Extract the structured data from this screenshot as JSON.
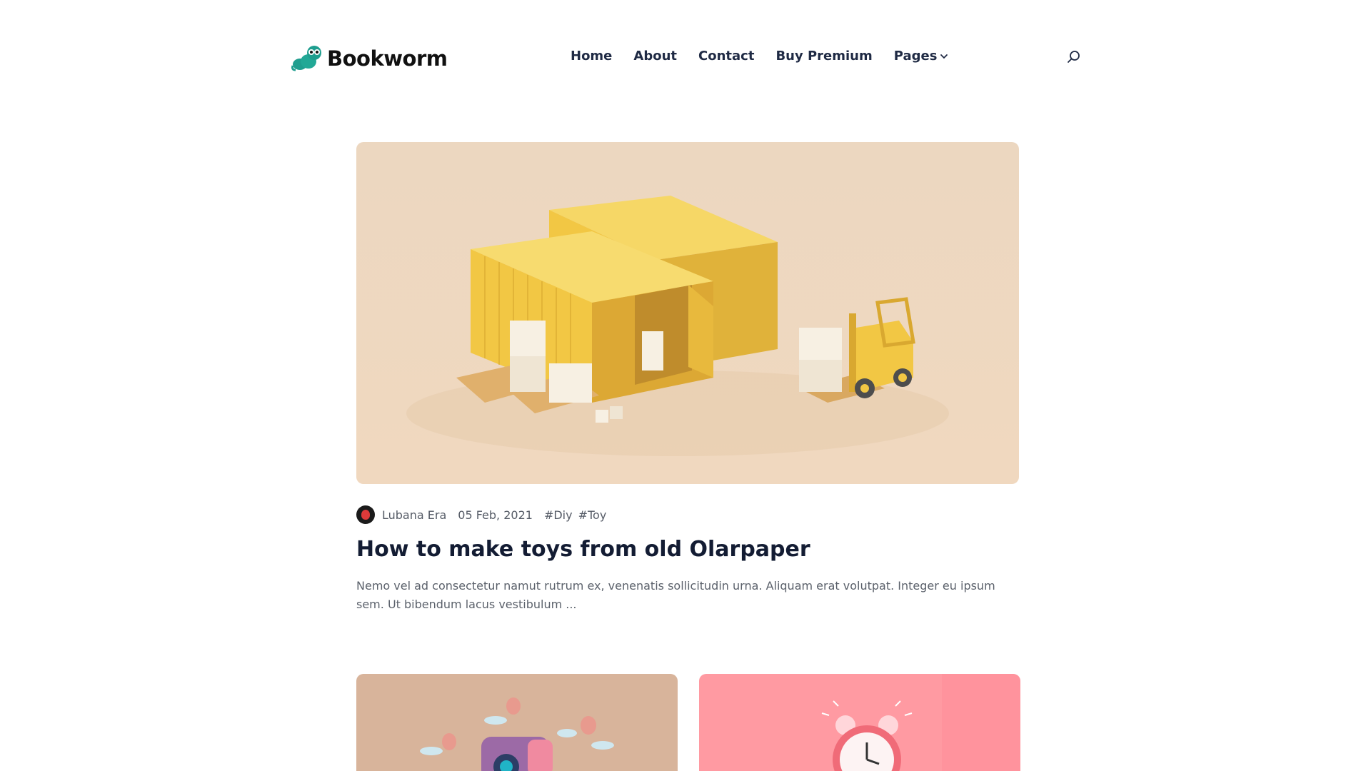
{
  "brand": {
    "name": "Bookworm",
    "logo_icon": "bookworm-logo-icon"
  },
  "nav": {
    "items": [
      {
        "label": "Home"
      },
      {
        "label": "About"
      },
      {
        "label": "Contact"
      },
      {
        "label": "Buy Premium"
      },
      {
        "label": "Pages",
        "has_dropdown": true
      }
    ],
    "search_icon": "search-icon"
  },
  "featured": {
    "image_icon": "shipping-containers-illustration",
    "author": "Lubana Era",
    "date": "05 Feb, 2021",
    "tags": [
      "#Diy",
      "#Toy"
    ],
    "title": "How to make toys from old Olarpaper",
    "excerpt": "Nemo vel ad consectetur namut rutrum ex, venenatis sollicitudin urna. Aliquam erat volutpat. Integer eu ipsum sem. Ut bibendum lacus vestibulum ..."
  },
  "cards": [
    {
      "image_icon": "camera-balloons-illustration"
    },
    {
      "image_icon": "alarm-clock-illustration"
    }
  ],
  "colors": {
    "brand_teal": "#1f9e8f",
    "heading": "#131c33",
    "nav_text": "#1f2a44",
    "muted_text": "#5b616b",
    "featured_bg": "#ecd7c0",
    "container_yellow": "#f2c744",
    "card1_bg": "#d8b49b",
    "card2_bg": "#ff9aa2"
  }
}
